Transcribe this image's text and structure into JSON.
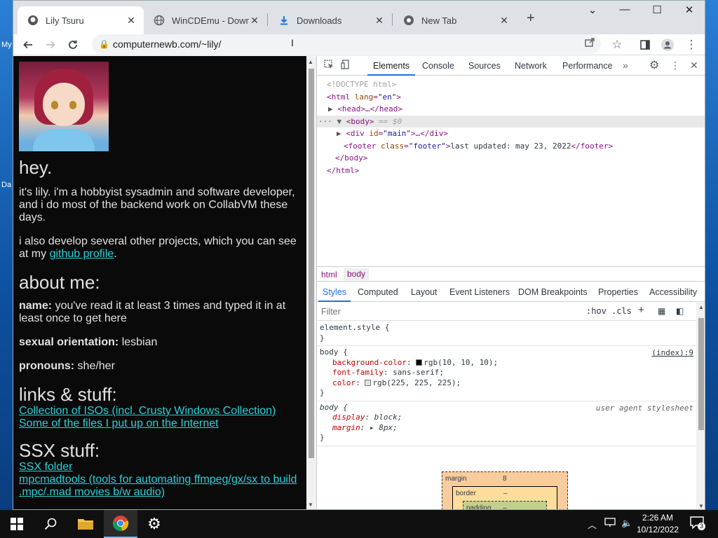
{
  "desktop": {
    "left_labels": [
      "My",
      "Da"
    ]
  },
  "browser": {
    "tabs": [
      {
        "title": "Lily Tsuru",
        "icon": "avatar-favicon",
        "active": true
      },
      {
        "title": "WinCDEmu - Downlo",
        "icon": "globe-icon",
        "active": false
      },
      {
        "title": "Downloads",
        "icon": "download-icon",
        "active": false
      },
      {
        "title": "New Tab",
        "icon": "chrome-icon",
        "active": false
      }
    ],
    "url": "computernewb.com/~lily/"
  },
  "page": {
    "heading_hey": "hey.",
    "intro": "it's lily. i'm a hobbyist sysadmin and software developer, and i do most of the backend work on CollabVM these days.",
    "projects_text": "i also develop several other projects, which you can see at my ",
    "github_link": "github profile",
    "projects_end": ".",
    "about_heading": "about me:",
    "about": [
      {
        "label": "name:",
        "value": " you've read it at least 3 times and typed it in at least once to get here"
      },
      {
        "label": "sexual orientation:",
        "value": " lesbian"
      },
      {
        "label": "pronouns:",
        "value": " she/her"
      }
    ],
    "links_heading": "links & stuff:",
    "links": [
      "Collection of ISOs (incl. Crusty Windows Collection)",
      "Some of the files I put up on the Internet"
    ],
    "ssx_heading": "SSX stuff:",
    "ssx_links": [
      "SSX folder",
      "mpcmadtools (tools for automating ffmpeg/gx/sx to build .mpc/.mad movies b/w audio)"
    ]
  },
  "devtools": {
    "tabs": [
      "Elements",
      "Console",
      "Sources",
      "Network",
      "Performance"
    ],
    "dom": {
      "doctype": "<!DOCTYPE html>",
      "html_open": "<html",
      "lang_attr": "lang",
      "lang_val": "\"en\"",
      "head": "<head>…</head>",
      "body_open": "<body>",
      "body_marker": " == $0",
      "div_open": "<div",
      "div_attr": "id",
      "div_val": "\"main\"",
      "div_rest": ">…</div>",
      "footer_open": "<footer",
      "footer_attr": "class",
      "footer_val": "\"footer\"",
      "footer_text": "last updated: may 23, 2022",
      "footer_close": "</footer>",
      "body_close": "</body>",
      "html_close": "</html>"
    },
    "breadcrumbs": [
      "html",
      "body"
    ],
    "subtabs": [
      "Styles",
      "Computed",
      "Layout",
      "Event Listeners",
      "DOM Breakpoints",
      "Properties",
      "Accessibility"
    ],
    "filter_placeholder": "Filter",
    "hov": ":hov",
    "cls": ".cls",
    "rules": {
      "element_style": "element.style {",
      "close": "}",
      "body_selector": "body {",
      "body_source": "(index):9",
      "bg_prop": "background-color",
      "bg_val": "rgb(10, 10, 10);",
      "ff_prop": "font-family",
      "ff_val": "sans-serif;",
      "color_prop": "color",
      "color_val": "rgb(225, 225, 225);",
      "ua_source": "user agent stylesheet",
      "display_prop": "display",
      "display_val": "block;",
      "margin_prop": "margin",
      "margin_val": "8px;"
    },
    "boxmodel": {
      "margin_label": "margin",
      "margin_val": "8",
      "border_label": "border",
      "border_val": "–",
      "padding_label": "padding",
      "padding_val": "–"
    }
  },
  "taskbar": {
    "time": "2:26 AM",
    "date": "10/12/2022",
    "notifications": "3"
  },
  "colors": {
    "link": "#2ad0d8",
    "page_bg": "#0a0a0a",
    "accent": "#1a73e8"
  }
}
